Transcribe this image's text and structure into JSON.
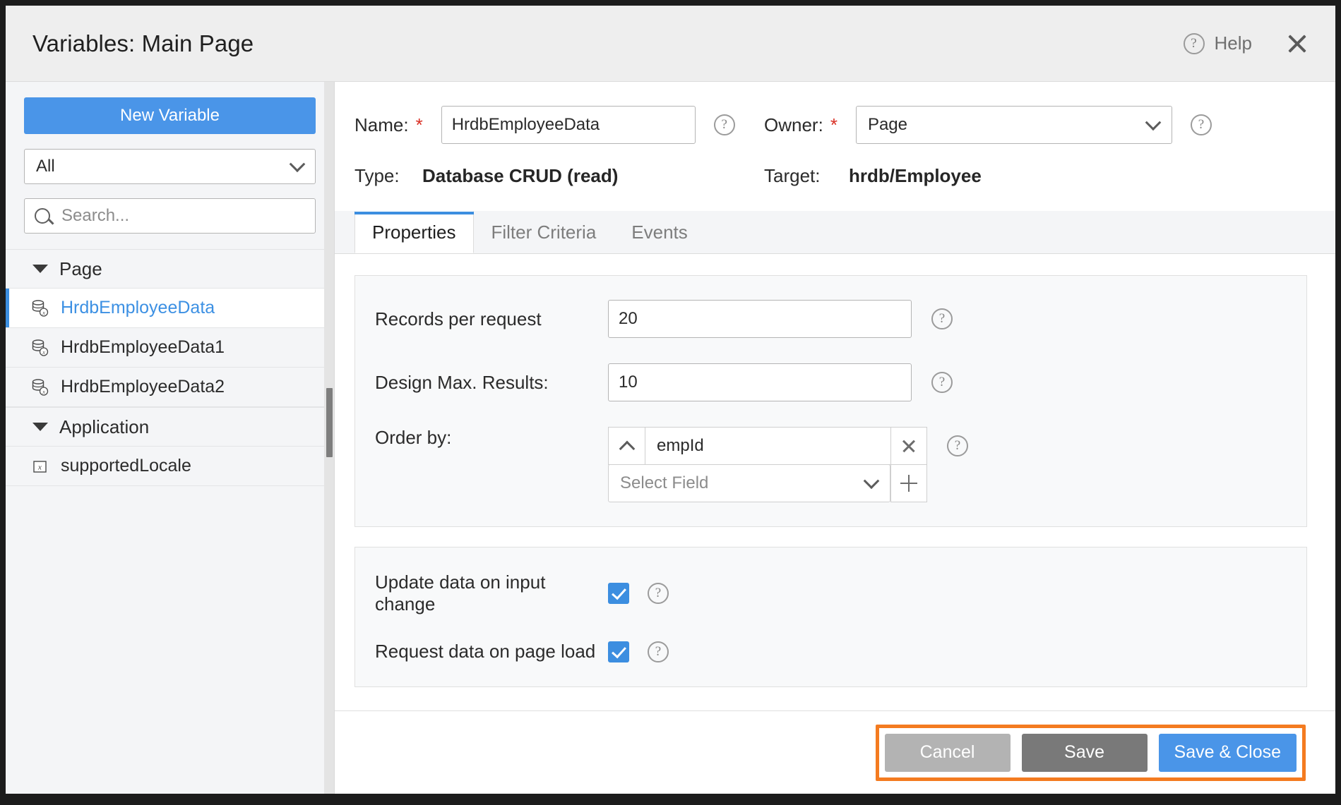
{
  "dialog": {
    "title": "Variables: Main Page",
    "help_label": "Help",
    "help_icon": "question-circle-icon",
    "close_icon": "close-icon"
  },
  "sidebar": {
    "new_variable_label": "New Variable",
    "filter": {
      "selected": "All",
      "chevron_icon": "chevron-down-icon"
    },
    "search": {
      "placeholder": "Search...",
      "value": "",
      "icon": "search-icon"
    },
    "tree": [
      {
        "type": "group",
        "label": "Page",
        "caret_icon": "caret-down-icon",
        "items": [
          {
            "label": "HrdbEmployeeData",
            "icon": "database-variable-icon",
            "selected": true
          },
          {
            "label": "HrdbEmployeeData1",
            "icon": "database-variable-icon",
            "selected": false
          },
          {
            "label": "HrdbEmployeeData2",
            "icon": "database-variable-icon",
            "selected": false
          }
        ]
      },
      {
        "type": "group",
        "label": "Application",
        "caret_icon": "caret-down-icon",
        "items": [
          {
            "label": "supportedLocale",
            "icon": "expression-variable-icon",
            "selected": false
          }
        ]
      }
    ],
    "scrollbar": "vertical-scrollbar"
  },
  "form": {
    "name": {
      "label": "Name:",
      "required_mark": "*",
      "value": "HrdbEmployeeData",
      "hint_icon": "question-circle-icon"
    },
    "owner": {
      "label": "Owner:",
      "required_mark": "*",
      "selected": "Page",
      "chevron_icon": "chevron-down-icon",
      "hint_icon": "question-circle-icon"
    },
    "type": {
      "label": "Type:",
      "value": "Database CRUD (read)"
    },
    "target": {
      "label": "Target:",
      "value": "hrdb/Employee"
    }
  },
  "tabs": [
    {
      "label": "Properties",
      "active": true
    },
    {
      "label": "Filter Criteria",
      "active": false
    },
    {
      "label": "Events",
      "active": false
    }
  ],
  "properties": {
    "records_per_request": {
      "label": "Records per request",
      "value": "20",
      "hint_icon": "question-circle-icon"
    },
    "design_max_results": {
      "label": "Design Max. Results:",
      "value": "10",
      "hint_icon": "question-circle-icon"
    },
    "order_by": {
      "label": "Order by:",
      "direction_icon": "chevron-up-icon",
      "field_value": "empId",
      "remove_icon": "close-icon",
      "select_placeholder": "Select Field",
      "select_chevron_icon": "chevron-down-icon",
      "add_icon": "plus-icon",
      "hint_icon": "question-circle-icon"
    },
    "update_on_input_change": {
      "label": "Update data on input change",
      "checked": true,
      "hint_icon": "question-circle-icon"
    },
    "request_on_page_load": {
      "label": "Request data on page load",
      "checked": true,
      "hint_icon": "question-circle-icon"
    }
  },
  "footer": {
    "cancel_label": "Cancel",
    "save_label": "Save",
    "save_close_label": "Save & Close",
    "highlight_color": "#f47b20"
  },
  "colors": {
    "accent_blue": "#4a95e8",
    "selected_blue": "#3c90e3",
    "required_red": "#d93025",
    "highlight_orange": "#f47b20"
  }
}
